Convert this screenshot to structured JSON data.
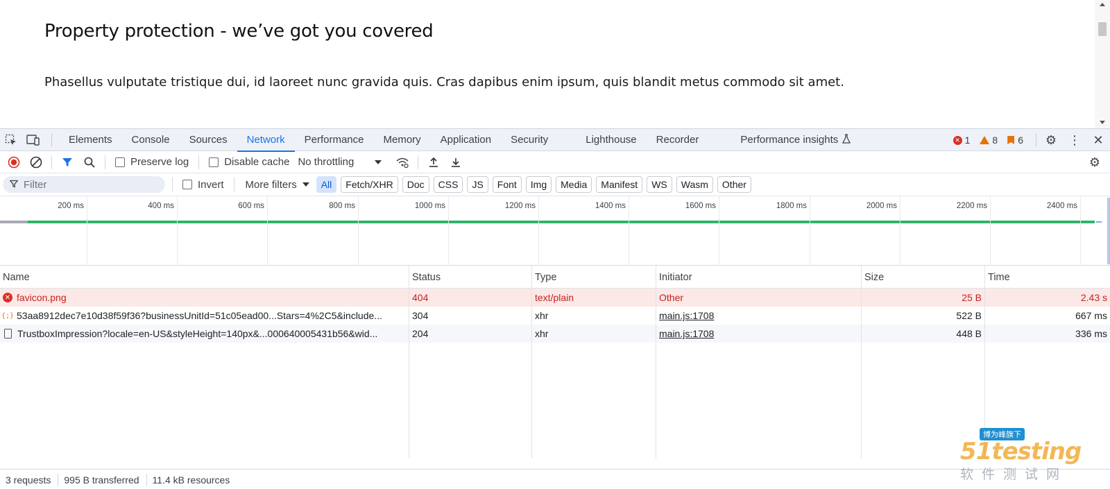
{
  "page": {
    "heading": "Property protection - we’ve got you covered",
    "paragraph": "Phasellus vulputate tristique dui, id laoreet nunc gravida quis. Cras dapibus enim ipsum, quis blandit metus commodo sit amet."
  },
  "devtools": {
    "tabs": [
      {
        "label": "Elements"
      },
      {
        "label": "Console"
      },
      {
        "label": "Sources"
      },
      {
        "label": "Network",
        "active": true
      },
      {
        "label": "Performance"
      },
      {
        "label": "Memory"
      },
      {
        "label": "Application"
      },
      {
        "label": "Security"
      },
      {
        "label": "Lighthouse"
      },
      {
        "label": "Recorder"
      },
      {
        "label": "Performance insights"
      }
    ],
    "counts": {
      "errors": "1",
      "warnings": "8",
      "issues": "6"
    },
    "toolbar": {
      "preserve_log": "Preserve log",
      "disable_cache": "Disable cache",
      "throttling": "No throttling"
    },
    "filterbar": {
      "filter_placeholder": "Filter",
      "invert": "Invert",
      "more_filters": "More filters",
      "types": [
        "All",
        "Fetch/XHR",
        "Doc",
        "CSS",
        "JS",
        "Font",
        "Img",
        "Media",
        "Manifest",
        "WS",
        "Wasm",
        "Other"
      ],
      "active_type": "All"
    },
    "timeline": {
      "ticks": [
        "200 ms",
        "400 ms",
        "600 ms",
        "800 ms",
        "1000 ms",
        "1200 ms",
        "1400 ms",
        "1600 ms",
        "1800 ms",
        "2000 ms",
        "2200 ms",
        "2400 ms"
      ]
    },
    "table": {
      "columns": [
        "Name",
        "Status",
        "Type",
        "Initiator",
        "Size",
        "Time"
      ],
      "rows": [
        {
          "name": "favicon.png",
          "status": "404",
          "type": "text/plain",
          "initiator": "Other",
          "size": "25 B",
          "time": "2.43 s",
          "icon": "error-icon",
          "error": true
        },
        {
          "name": "53aa8912dec7e10d38f59f36?businessUnitId=51c05ead00...Stars=4%2C5&include...",
          "status": "304",
          "type": "xhr",
          "initiator": "main.js:1708",
          "size": "522 B",
          "time": "667 ms",
          "icon": "xhr-icon",
          "error": false
        },
        {
          "name": "TrustboxImpression?locale=en-US&styleHeight=140px&...000640005431b56&wid...",
          "status": "204",
          "type": "xhr",
          "initiator": "main.js:1708",
          "size": "448 B",
          "time": "336 ms",
          "icon": "document-icon",
          "error": false
        }
      ]
    },
    "statusbar": {
      "requests": "3 requests",
      "transferred": "995 B transferred",
      "resources": "11.4 kB resources"
    }
  },
  "watermark": {
    "tag": "博为峰旗下",
    "logo": "51testing",
    "sub": "软件测试网"
  },
  "colors": {
    "accent": "#1a73e8",
    "error": "#d93025",
    "error_row_bg": "#fce8e6",
    "timeline_bar": "#2fb46a"
  }
}
